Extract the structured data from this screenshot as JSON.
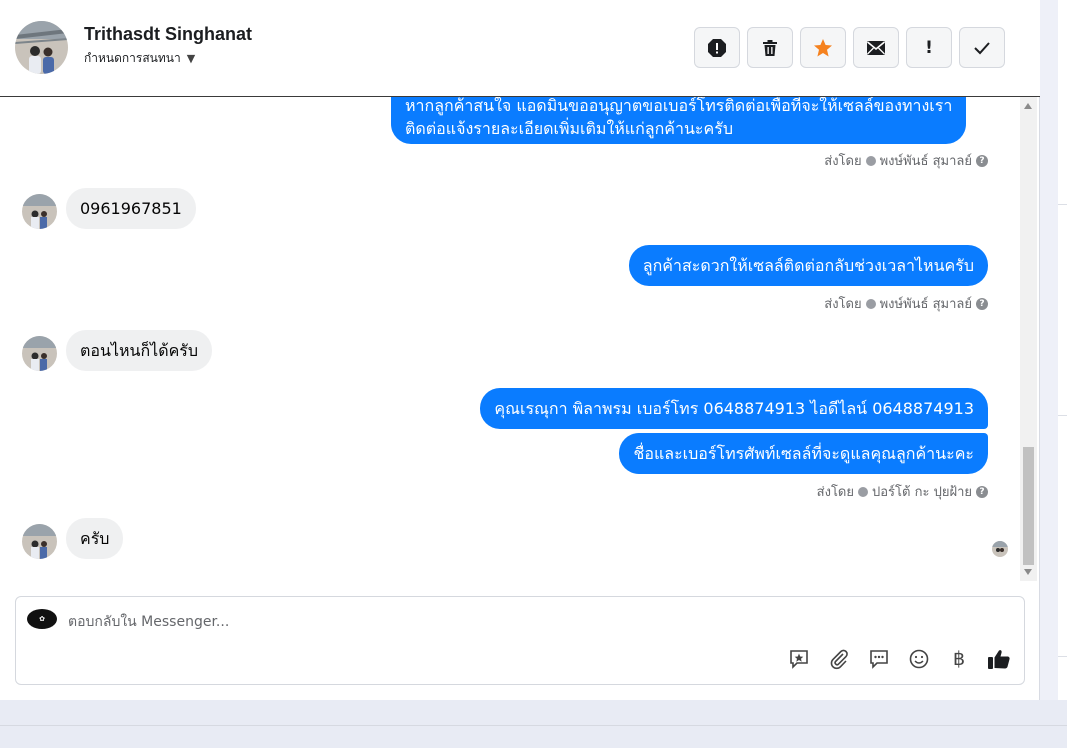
{
  "header": {
    "contact_name": "Trithasdt Singhanat",
    "assign_label": "กำหนดการสนทนา",
    "toolbar": [
      {
        "icon": "alert-octagon-icon",
        "glyph": "!"
      },
      {
        "icon": "trash-icon",
        "glyph": ""
      },
      {
        "icon": "star-icon",
        "glyph": "★"
      },
      {
        "icon": "envelope-icon",
        "glyph": ""
      },
      {
        "icon": "exclamation-icon",
        "glyph": "!"
      },
      {
        "icon": "checkmark-icon",
        "glyph": "✓"
      }
    ],
    "star_color": "#f5821f"
  },
  "messages": {
    "m1_line1": "หากลูกค้าสนใจ แอดมินขออนุญาตขอเบอร์โทรติดต่อเพื่อที่จะให้เซลล์ของทางเรา",
    "m1_line2": "ติดต่อแจ้งรายละเอียดเพิ่มเติมให้แก่ลูกค้านะครับ",
    "m1_sentby": "ส่งโดย",
    "m1_sender": "พงษ์พันธ์ สุมาลย์",
    "m2_text": "0961967851",
    "m3_text": "ลูกค้าสะดวกให้เซลล์ติดต่อกลับช่วงเวลาไหนครับ",
    "m3_sentby": "ส่งโดย",
    "m3_sender": "พงษ์พันธ์ สุมาลย์",
    "m4_text": "ตอนไหนก็ได้ครับ",
    "m5_text": "คุณเรณุกา พิลาพรม        เบอร์โทร 0648874913  ไอดีไลน์ 0648874913",
    "m6_text": "ชื่อและเบอร์โทรศัพท์เซลล์ที่จะดูแลคุณลูกค้านะคะ",
    "m6_sentby": "ส่งโดย",
    "m6_sender": "ปอร์โต้ กะ ปุยฝ้าย",
    "m7_text": "ครับ",
    "bubble_color": "#0a7cff"
  },
  "composer": {
    "placeholder": "ตอบกลับใน Messenger...",
    "tools": [
      "saved-reply-icon",
      "paperclip-icon",
      "quick-reply-icon",
      "emoji-icon",
      "baht-icon",
      "thumbs-up-icon"
    ],
    "baht_glyph": "฿"
  }
}
